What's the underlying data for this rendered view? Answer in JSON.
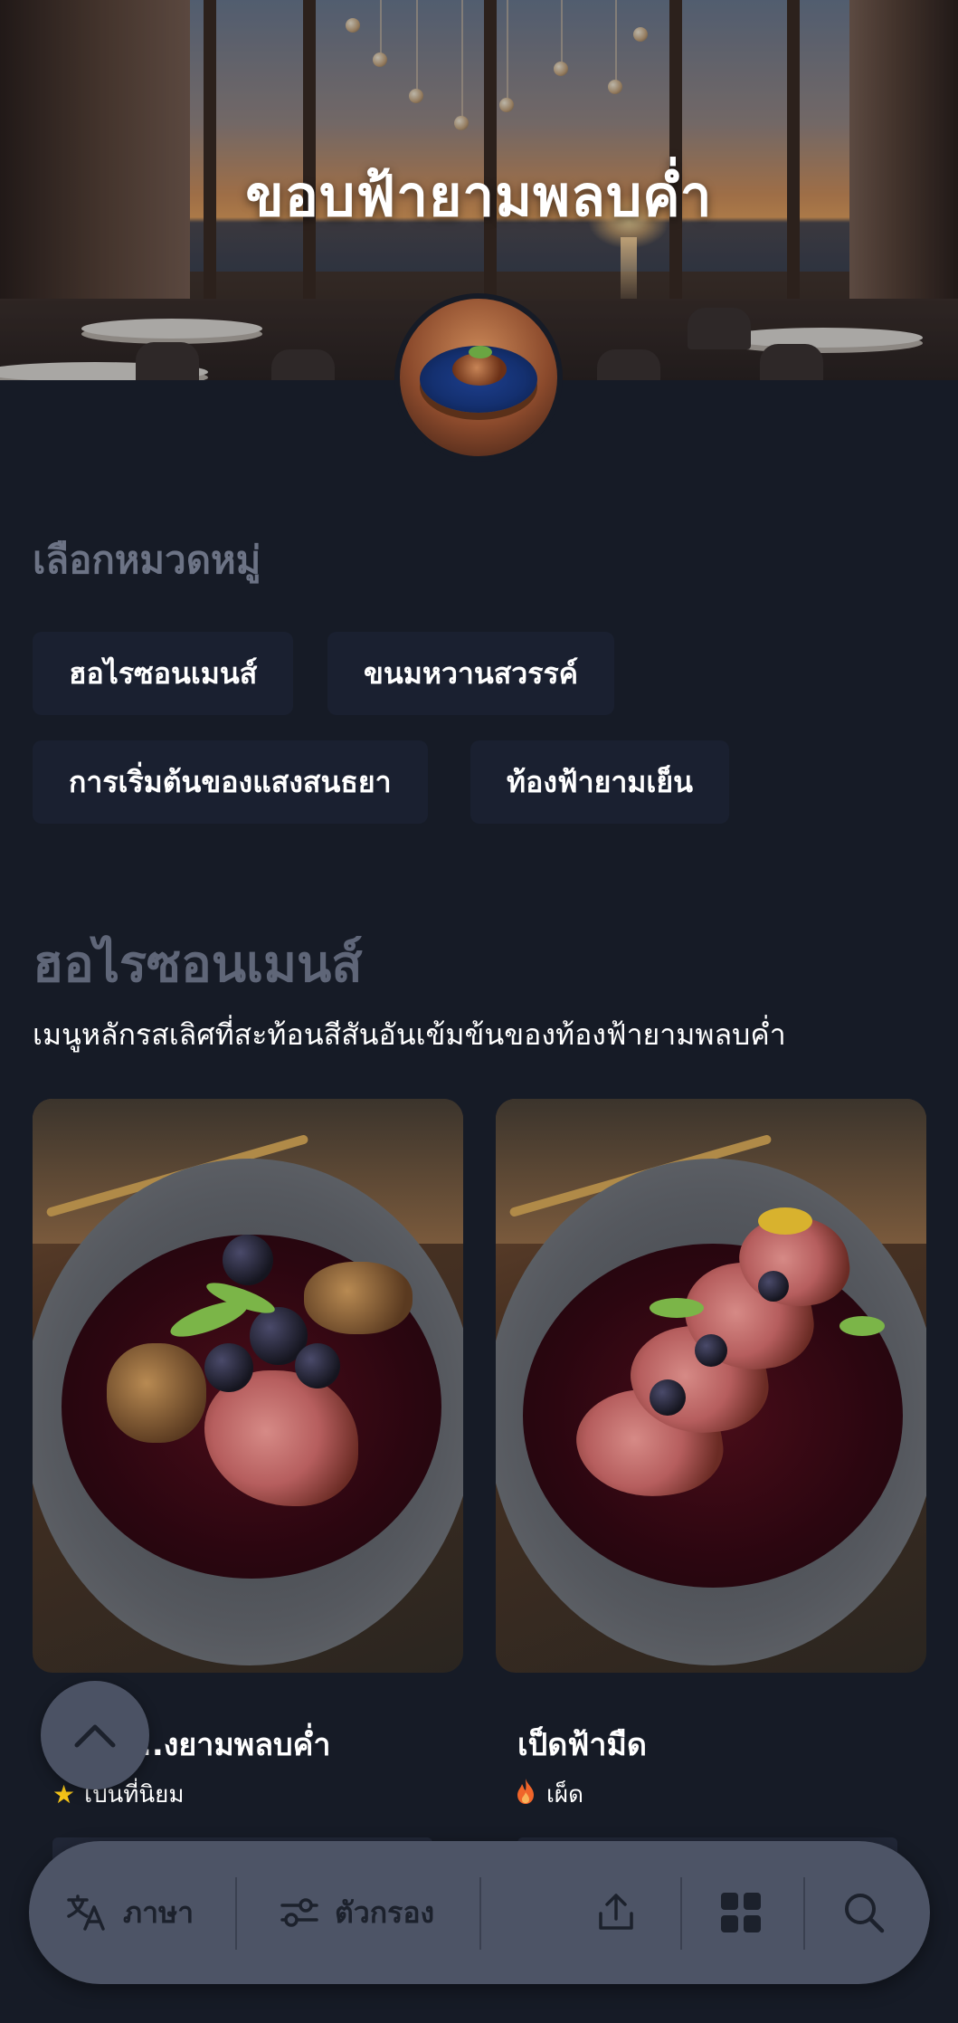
{
  "hero": {
    "title": "ขอบฟ้ายามพลบค่ำ"
  },
  "categories": {
    "label": "เลือกหมวดหมู่",
    "chips": [
      "ฮอไรซอนเมนส์",
      "ขนมหวานสวรรค์",
      "การเริ่มต้นของแสงสนธยา",
      "ท้องฟ้ายามเย็น"
    ]
  },
  "menu_section": {
    "title": "ฮอไรซอนเมนส์",
    "description": "เมนูหลักรสเลิศที่สะท้อนสีสันอันเข้มข้นของท้องฟ้ายามพลบค่ำ",
    "items": [
      {
        "name": "...งยามพลบค่ำ",
        "tag": "เป็นที่นิยม",
        "tag_icon": "star-icon",
        "tag_color": "#f5c518"
      },
      {
        "name": "เป็ดฟ้ามืด",
        "tag": "เผ็ด",
        "tag_icon": "fire-icon",
        "tag_color": "#f0652a"
      }
    ]
  },
  "bottom_bar": {
    "language_label": "ภาษา",
    "filter_label": "ตัวกรอง"
  },
  "colors": {
    "background": "#161b26",
    "chip_bg": "#1a2030",
    "bottom_bar_bg": "#4d5466",
    "muted_heading": "#6c7385"
  }
}
